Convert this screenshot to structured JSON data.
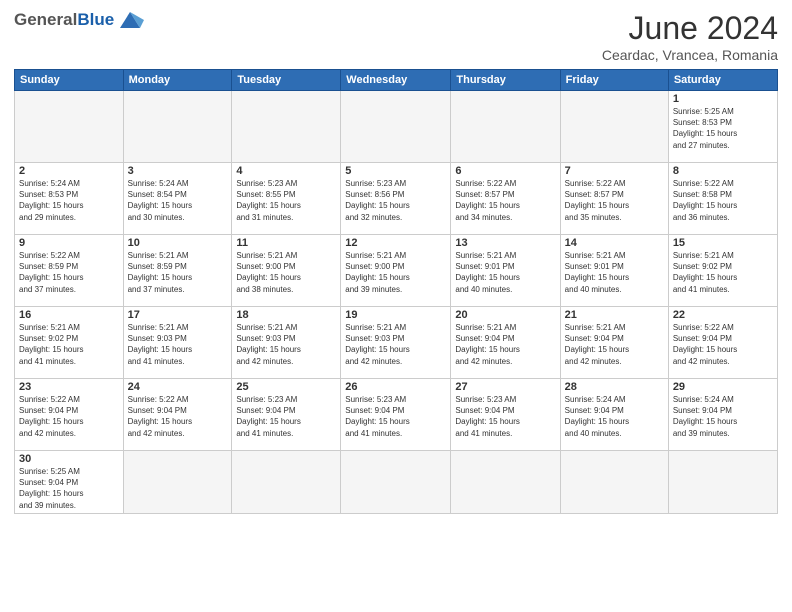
{
  "header": {
    "logo": {
      "general": "General",
      "blue": "Blue",
      "subtitle": ""
    },
    "title": "June 2024",
    "location": "Ceardac, Vrancea, Romania"
  },
  "weekdays": [
    "Sunday",
    "Monday",
    "Tuesday",
    "Wednesday",
    "Thursday",
    "Friday",
    "Saturday"
  ],
  "weeks": [
    [
      {
        "day": "",
        "info": ""
      },
      {
        "day": "",
        "info": ""
      },
      {
        "day": "",
        "info": ""
      },
      {
        "day": "",
        "info": ""
      },
      {
        "day": "",
        "info": ""
      },
      {
        "day": "",
        "info": ""
      },
      {
        "day": "1",
        "info": "Sunrise: 5:25 AM\nSunset: 8:53 PM\nDaylight: 15 hours\nand 27 minutes."
      }
    ],
    [
      {
        "day": "2",
        "info": "Sunrise: 5:24 AM\nSunset: 8:53 PM\nDaylight: 15 hours\nand 29 minutes."
      },
      {
        "day": "3",
        "info": "Sunrise: 5:24 AM\nSunset: 8:54 PM\nDaylight: 15 hours\nand 30 minutes."
      },
      {
        "day": "4",
        "info": "Sunrise: 5:23 AM\nSunset: 8:55 PM\nDaylight: 15 hours\nand 31 minutes."
      },
      {
        "day": "5",
        "info": "Sunrise: 5:23 AM\nSunset: 8:56 PM\nDaylight: 15 hours\nand 32 minutes."
      },
      {
        "day": "6",
        "info": "Sunrise: 5:22 AM\nSunset: 8:57 PM\nDaylight: 15 hours\nand 34 minutes."
      },
      {
        "day": "7",
        "info": "Sunrise: 5:22 AM\nSunset: 8:57 PM\nDaylight: 15 hours\nand 35 minutes."
      },
      {
        "day": "8",
        "info": "Sunrise: 5:22 AM\nSunset: 8:58 PM\nDaylight: 15 hours\nand 36 minutes."
      }
    ],
    [
      {
        "day": "9",
        "info": "Sunrise: 5:22 AM\nSunset: 8:59 PM\nDaylight: 15 hours\nand 37 minutes."
      },
      {
        "day": "10",
        "info": "Sunrise: 5:21 AM\nSunset: 8:59 PM\nDaylight: 15 hours\nand 37 minutes."
      },
      {
        "day": "11",
        "info": "Sunrise: 5:21 AM\nSunset: 9:00 PM\nDaylight: 15 hours\nand 38 minutes."
      },
      {
        "day": "12",
        "info": "Sunrise: 5:21 AM\nSunset: 9:00 PM\nDaylight: 15 hours\nand 39 minutes."
      },
      {
        "day": "13",
        "info": "Sunrise: 5:21 AM\nSunset: 9:01 PM\nDaylight: 15 hours\nand 40 minutes."
      },
      {
        "day": "14",
        "info": "Sunrise: 5:21 AM\nSunset: 9:01 PM\nDaylight: 15 hours\nand 40 minutes."
      },
      {
        "day": "15",
        "info": "Sunrise: 5:21 AM\nSunset: 9:02 PM\nDaylight: 15 hours\nand 41 minutes."
      }
    ],
    [
      {
        "day": "16",
        "info": "Sunrise: 5:21 AM\nSunset: 9:02 PM\nDaylight: 15 hours\nand 41 minutes."
      },
      {
        "day": "17",
        "info": "Sunrise: 5:21 AM\nSunset: 9:03 PM\nDaylight: 15 hours\nand 41 minutes."
      },
      {
        "day": "18",
        "info": "Sunrise: 5:21 AM\nSunset: 9:03 PM\nDaylight: 15 hours\nand 42 minutes."
      },
      {
        "day": "19",
        "info": "Sunrise: 5:21 AM\nSunset: 9:03 PM\nDaylight: 15 hours\nand 42 minutes."
      },
      {
        "day": "20",
        "info": "Sunrise: 5:21 AM\nSunset: 9:04 PM\nDaylight: 15 hours\nand 42 minutes."
      },
      {
        "day": "21",
        "info": "Sunrise: 5:21 AM\nSunset: 9:04 PM\nDaylight: 15 hours\nand 42 minutes."
      },
      {
        "day": "22",
        "info": "Sunrise: 5:22 AM\nSunset: 9:04 PM\nDaylight: 15 hours\nand 42 minutes."
      }
    ],
    [
      {
        "day": "23",
        "info": "Sunrise: 5:22 AM\nSunset: 9:04 PM\nDaylight: 15 hours\nand 42 minutes."
      },
      {
        "day": "24",
        "info": "Sunrise: 5:22 AM\nSunset: 9:04 PM\nDaylight: 15 hours\nand 42 minutes."
      },
      {
        "day": "25",
        "info": "Sunrise: 5:23 AM\nSunset: 9:04 PM\nDaylight: 15 hours\nand 41 minutes."
      },
      {
        "day": "26",
        "info": "Sunrise: 5:23 AM\nSunset: 9:04 PM\nDaylight: 15 hours\nand 41 minutes."
      },
      {
        "day": "27",
        "info": "Sunrise: 5:23 AM\nSunset: 9:04 PM\nDaylight: 15 hours\nand 41 minutes."
      },
      {
        "day": "28",
        "info": "Sunrise: 5:24 AM\nSunset: 9:04 PM\nDaylight: 15 hours\nand 40 minutes."
      },
      {
        "day": "29",
        "info": "Sunrise: 5:24 AM\nSunset: 9:04 PM\nDaylight: 15 hours\nand 39 minutes."
      }
    ],
    [
      {
        "day": "30",
        "info": "Sunrise: 5:25 AM\nSunset: 9:04 PM\nDaylight: 15 hours\nand 39 minutes."
      },
      {
        "day": "",
        "info": ""
      },
      {
        "day": "",
        "info": ""
      },
      {
        "day": "",
        "info": ""
      },
      {
        "day": "",
        "info": ""
      },
      {
        "day": "",
        "info": ""
      },
      {
        "day": "",
        "info": ""
      }
    ]
  ]
}
